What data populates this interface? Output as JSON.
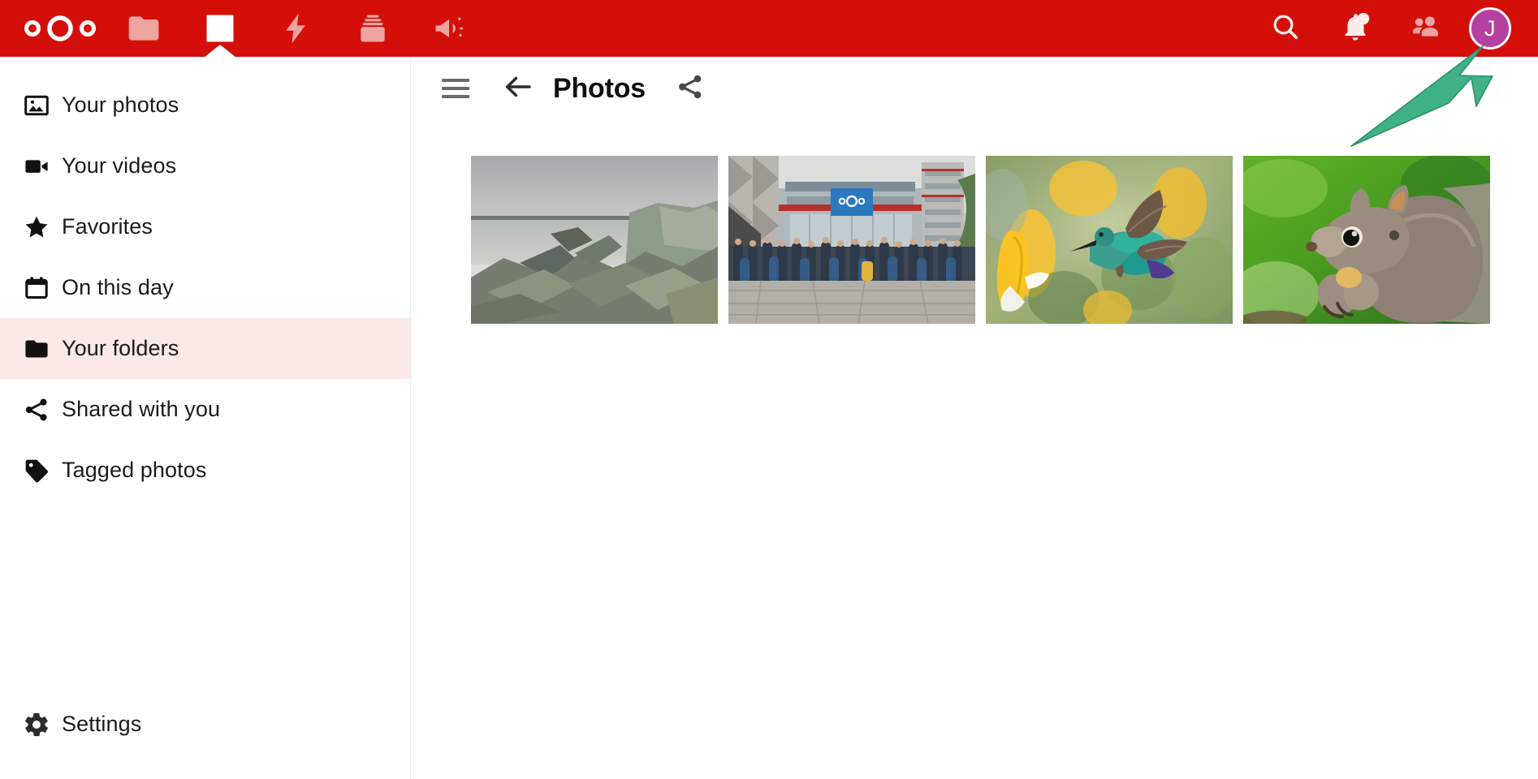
{
  "header": {
    "background_color": "#d40f09",
    "logo": {
      "name": "nextcloud-logo",
      "alt": "Nextcloud"
    },
    "apps": [
      {
        "id": "files",
        "icon": "folder-icon",
        "label": "Files",
        "active": false
      },
      {
        "id": "photos",
        "icon": "photos-icon",
        "label": "Photos",
        "active": true
      },
      {
        "id": "activity",
        "icon": "lightning-icon",
        "label": "Activity",
        "active": false
      },
      {
        "id": "deck",
        "icon": "deck-icon",
        "label": "Deck",
        "active": false
      },
      {
        "id": "announcements",
        "icon": "megaphone-icon",
        "label": "Announcements",
        "active": false
      }
    ],
    "actions": [
      {
        "id": "search",
        "icon": "search-icon",
        "label": "Search"
      },
      {
        "id": "notifications",
        "icon": "bell-icon",
        "label": "Notifications",
        "has_dot": true
      },
      {
        "id": "contacts",
        "icon": "contacts-icon",
        "label": "Contacts"
      }
    ],
    "avatar": {
      "initial": "J",
      "background_color": "#b5419f",
      "ring_color": "#ffffff",
      "label": "Settings menu"
    }
  },
  "sidebar": {
    "items": [
      {
        "label": "Your photos",
        "icon": "image-icon",
        "selected": false
      },
      {
        "label": "Your videos",
        "icon": "video-icon",
        "selected": false
      },
      {
        "label": "Favorites",
        "icon": "star-icon",
        "selected": false
      },
      {
        "label": "On this day",
        "icon": "calendar-icon",
        "selected": false
      },
      {
        "label": "Your folders",
        "icon": "folder-icon",
        "selected": true
      },
      {
        "label": "Shared with you",
        "icon": "share-icon",
        "selected": false
      },
      {
        "label": "Tagged photos",
        "icon": "tag-icon",
        "selected": false
      }
    ],
    "bottom": {
      "label": "Settings",
      "icon": "gear-icon"
    },
    "selected_background": "#fae9e7"
  },
  "main": {
    "menu_toggle": {
      "icon": "hamburger-icon",
      "label": "Toggle navigation"
    },
    "back": {
      "icon": "arrow-left-icon",
      "label": "Back"
    },
    "title": "Photos",
    "share": {
      "icon": "share-icon",
      "label": "Share folder"
    },
    "photos": [
      {
        "name": "coastal-rocks",
        "alt": "Rocky coastline under overcast sky"
      },
      {
        "name": "community-group",
        "alt": "Nextcloud community group photo in front of building"
      },
      {
        "name": "hummingbird",
        "alt": "Hummingbird feeding at yellow flowers"
      },
      {
        "name": "squirrel",
        "alt": "Grey squirrel eating a nut"
      }
    ]
  },
  "annotation": {
    "arrow": {
      "name": "highlight-arrow",
      "color": "#3fb286",
      "points_to": "avatar",
      "direction": "up-right"
    }
  }
}
